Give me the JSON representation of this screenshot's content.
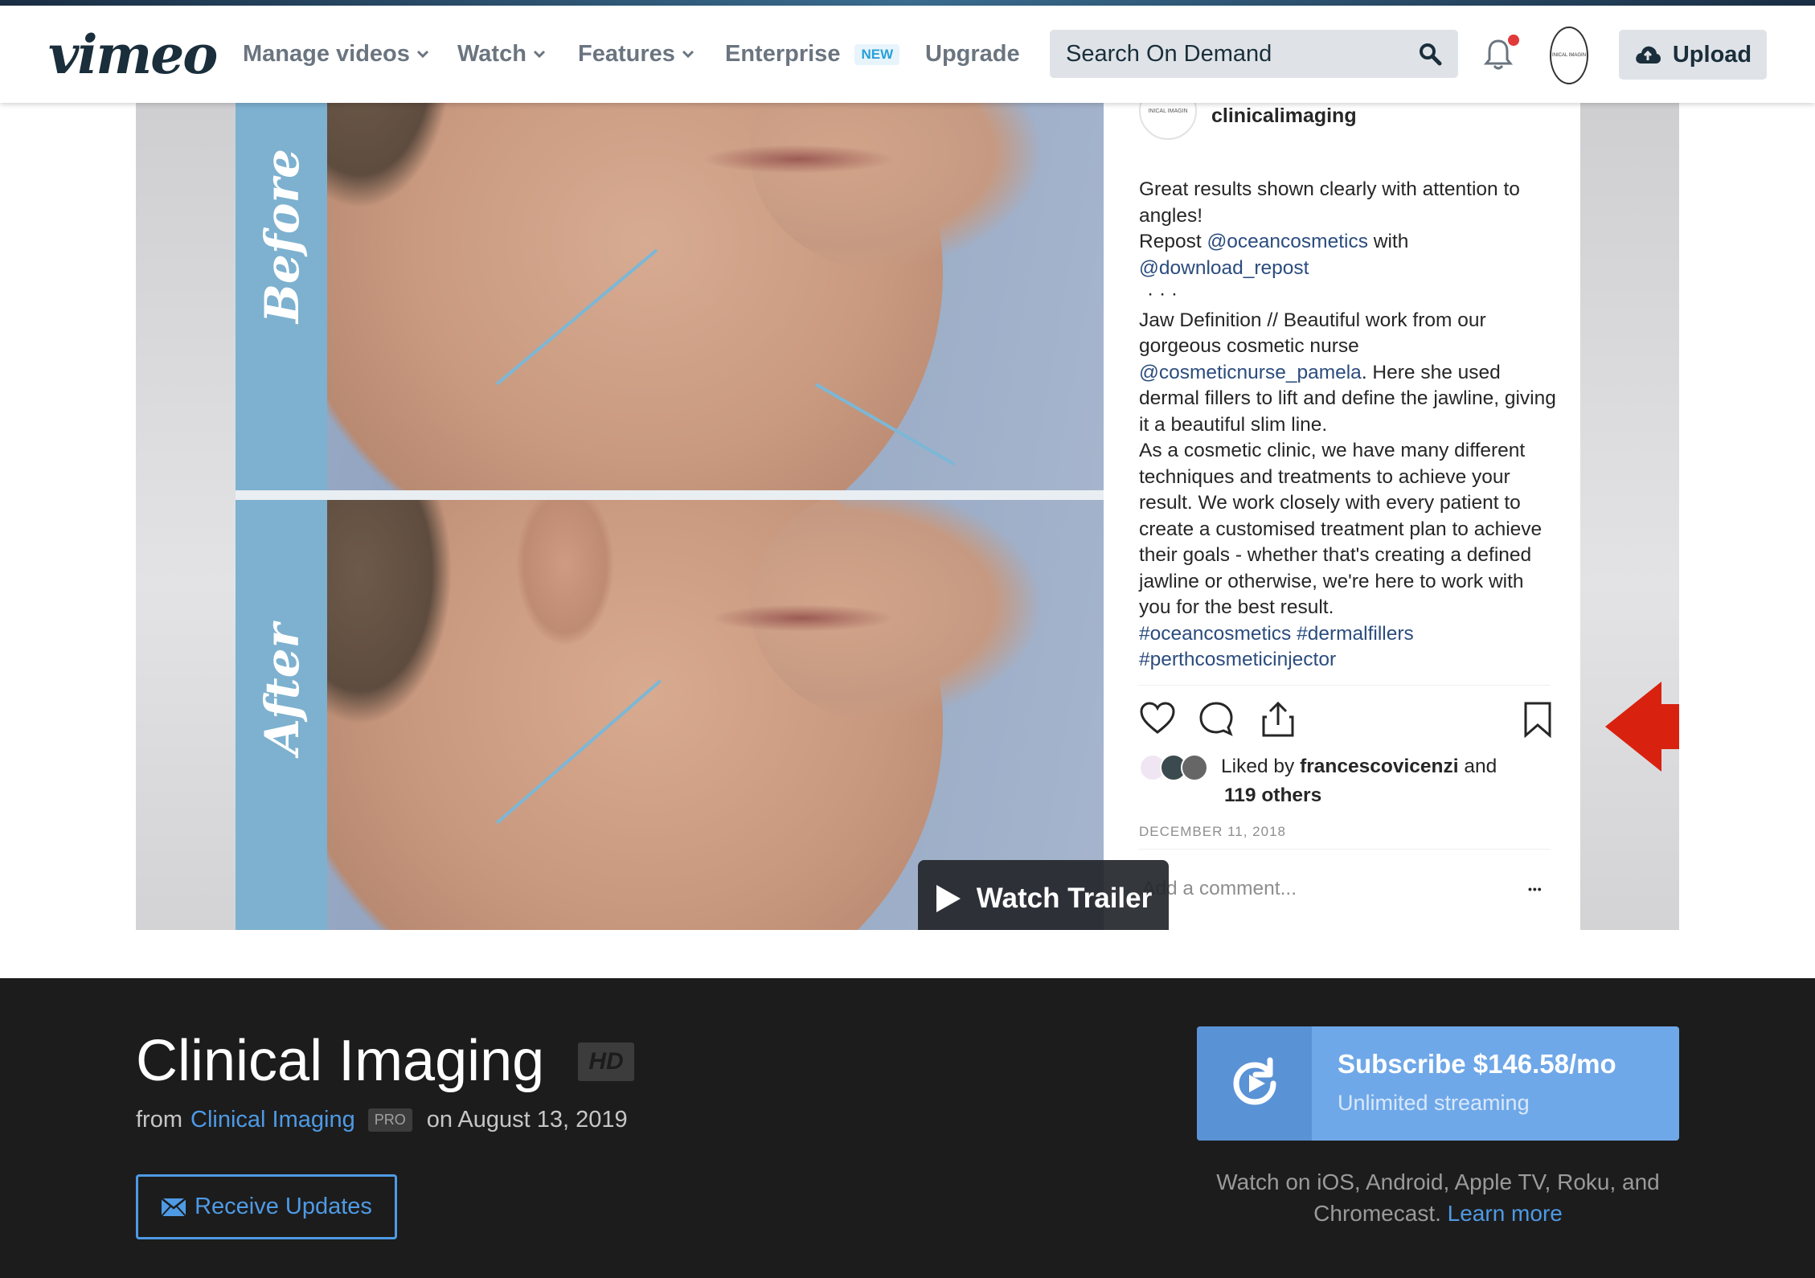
{
  "nav": {
    "logo": "vimeo",
    "items": [
      {
        "label": "Manage videos",
        "has_chevron": true
      },
      {
        "label": "Watch",
        "has_chevron": true
      },
      {
        "label": "Features",
        "has_chevron": true
      },
      {
        "label": "Enterprise",
        "badge": "NEW"
      },
      {
        "label": "Upgrade"
      }
    ],
    "search_placeholder": "Search On Demand",
    "upload_label": "Upload",
    "icons": [
      "search-icon",
      "bell-icon",
      "avatar",
      "cloud-upload-icon"
    ]
  },
  "video": {
    "before_label": "Before",
    "after_label": "After",
    "watch_trailer_label": "Watch Trailer",
    "side_icons": [
      "clock-icon",
      "layers-icon",
      "send-icon"
    ],
    "post": {
      "avatar_text": "INICAL IMAGIN",
      "username": "clinicalimaging",
      "caption": {
        "line1": "Great results shown clearly with attention to angles!",
        "repost_prefix": "Repost ",
        "repost_user": "@oceancosmetics",
        "repost_with": " with",
        "repost_app": "@download_repost",
        "dots": "·   ·   ·",
        "p2_start": "Jaw Definition // Beautiful work from our gorgeous cosmetic nurse ",
        "p2_user": "@cosmeticnurse_pamela",
        "p2_end": ". Here she used dermal fillers to lift and define the jawline, giving it a beautiful slim line.",
        "p3": "As a cosmetic clinic, we have many different techniques and treatments to achieve your result. We work closely with every patient to create a customised treatment plan to achieve their goals - whether that's creating a defined jawline or otherwise, we're here to work with you for the best result.",
        "hashtags": "#oceancosmetics #dermalfillers #perthcosmeticinjector"
      },
      "liked_prefix": "Liked by ",
      "liked_user": "francescovicenzi",
      "liked_suffix": " and",
      "liked_others": "119 others",
      "date": "DECEMBER 11, 2018",
      "comment_placeholder": "Add a comment...",
      "more": "•••"
    }
  },
  "info": {
    "title": "Clinical Imaging",
    "hd_badge": "HD",
    "from": "from",
    "channel": "Clinical Imaging",
    "pro_badge": "PRO",
    "date": "on August 13, 2019",
    "receive_label": "Receive Updates",
    "subscribe_title": "Subscribe $146.58/mo",
    "subscribe_sub": "Unlimited streaming",
    "platforms_text": "Watch on iOS, Android, Apple TV, Roku, and Chromecast.",
    "learn_more": "Learn more"
  },
  "colors": {
    "brand_dark": "#1a2e3b",
    "link_blue": "#4e9ae5",
    "subscribe_blue": "#6fa8e8",
    "dark_bg": "#1c1c1c",
    "before_after_strip": "#7db1cf",
    "annotation_red": "#d8220f"
  }
}
